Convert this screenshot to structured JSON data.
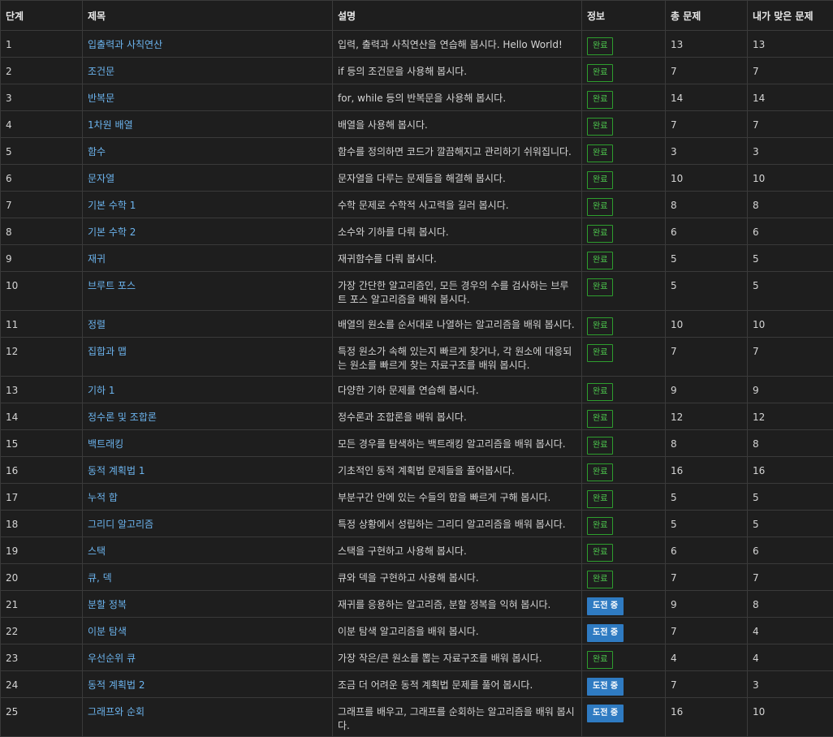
{
  "headers": [
    "단계",
    "제목",
    "설명",
    "정보",
    "총 문제",
    "내가 맞은 문제"
  ],
  "status_labels": {
    "done": "완료",
    "trying": "도전 중"
  },
  "colors": {
    "link": "#6cb4ee",
    "done": "#4ec94e",
    "trying": "#2f7bc2",
    "background": "#1e1e1e"
  },
  "rows": [
    {
      "step": "1",
      "title": "입출력과 사칙연산",
      "desc": "입력, 출력과 사칙연산을 연습해 봅시다. Hello World!",
      "status": "done",
      "status_label": "완료",
      "total": "13",
      "solved": "13"
    },
    {
      "step": "2",
      "title": "조건문",
      "desc": "if 등의 조건문을 사용해 봅시다.",
      "status": "done",
      "status_label": "완료",
      "total": "7",
      "solved": "7"
    },
    {
      "step": "3",
      "title": "반복문",
      "desc": "for, while 등의 반복문을 사용해 봅시다.",
      "status": "done",
      "status_label": "완료",
      "total": "14",
      "solved": "14"
    },
    {
      "step": "4",
      "title": "1차원 배열",
      "desc": "배열을 사용해 봅시다.",
      "status": "done",
      "status_label": "완료",
      "total": "7",
      "solved": "7"
    },
    {
      "step": "5",
      "title": "함수",
      "desc": "함수를 정의하면 코드가 깔끔해지고 관리하기 쉬워집니다.",
      "status": "done",
      "status_label": "완료",
      "total": "3",
      "solved": "3"
    },
    {
      "step": "6",
      "title": "문자열",
      "desc": "문자열을 다루는 문제들을 해결해 봅시다.",
      "status": "done",
      "status_label": "완료",
      "total": "10",
      "solved": "10"
    },
    {
      "step": "7",
      "title": "기본 수학 1",
      "desc": "수학 문제로 수학적 사고력을 길러 봅시다.",
      "status": "done",
      "status_label": "완료",
      "total": "8",
      "solved": "8"
    },
    {
      "step": "8",
      "title": "기본 수학 2",
      "desc": "소수와 기하를 다뤄 봅시다.",
      "status": "done",
      "status_label": "완료",
      "total": "6",
      "solved": "6"
    },
    {
      "step": "9",
      "title": "재귀",
      "desc": "재귀함수를 다뤄 봅시다.",
      "status": "done",
      "status_label": "완료",
      "total": "5",
      "solved": "5"
    },
    {
      "step": "10",
      "title": "브루트 포스",
      "desc": "가장 간단한 알고리즘인, 모든 경우의 수를 검사하는 브루트 포스 알고리즘을 배워 봅시다.",
      "status": "done",
      "status_label": "완료",
      "total": "5",
      "solved": "5"
    },
    {
      "step": "11",
      "title": "정렬",
      "desc": "배열의 원소를 순서대로 나열하는 알고리즘을 배워 봅시다.",
      "status": "done",
      "status_label": "완료",
      "total": "10",
      "solved": "10"
    },
    {
      "step": "12",
      "title": "집합과 맵",
      "desc": "특정 원소가 속해 있는지 빠르게 찾거나, 각 원소에 대응되는 원소를 빠르게 찾는 자료구조를 배워 봅시다.",
      "status": "done",
      "status_label": "완료",
      "total": "7",
      "solved": "7"
    },
    {
      "step": "13",
      "title": "기하 1",
      "desc": "다양한 기하 문제를 연습해 봅시다.",
      "status": "done",
      "status_label": "완료",
      "total": "9",
      "solved": "9"
    },
    {
      "step": "14",
      "title": "정수론 및 조합론",
      "desc": "정수론과 조합론을 배워 봅시다.",
      "status": "done",
      "status_label": "완료",
      "total": "12",
      "solved": "12"
    },
    {
      "step": "15",
      "title": "백트래킹",
      "desc": "모든 경우를 탐색하는 백트래킹 알고리즘을 배워 봅시다.",
      "status": "done",
      "status_label": "완료",
      "total": "8",
      "solved": "8"
    },
    {
      "step": "16",
      "title": "동적 계획법 1",
      "desc": "기초적인 동적 계획법 문제들을 풀어봅시다.",
      "status": "done",
      "status_label": "완료",
      "total": "16",
      "solved": "16"
    },
    {
      "step": "17",
      "title": "누적 합",
      "desc": "부분구간 안에 있는 수들의 합을 빠르게 구해 봅시다.",
      "status": "done",
      "status_label": "완료",
      "total": "5",
      "solved": "5"
    },
    {
      "step": "18",
      "title": "그리디 알고리즘",
      "desc": "특정 상황에서 성립하는 그리디 알고리즘을 배워 봅시다.",
      "status": "done",
      "status_label": "완료",
      "total": "5",
      "solved": "5"
    },
    {
      "step": "19",
      "title": "스택",
      "desc": "스택을 구현하고 사용해 봅시다.",
      "status": "done",
      "status_label": "완료",
      "total": "6",
      "solved": "6"
    },
    {
      "step": "20",
      "title": "큐, 덱",
      "desc": "큐와 덱을 구현하고 사용해 봅시다.",
      "status": "done",
      "status_label": "완료",
      "total": "7",
      "solved": "7"
    },
    {
      "step": "21",
      "title": "분할 정복",
      "desc": "재귀를 응용하는 알고리즘, 분할 정복을 익혀 봅시다.",
      "status": "trying",
      "status_label": "도전 중",
      "total": "9",
      "solved": "8"
    },
    {
      "step": "22",
      "title": "이분 탐색",
      "desc": "이분 탐색 알고리즘을 배워 봅시다.",
      "status": "trying",
      "status_label": "도전 중",
      "total": "7",
      "solved": "4"
    },
    {
      "step": "23",
      "title": "우선순위 큐",
      "desc": "가장 작은/큰 원소를 뽑는 자료구조를 배워 봅시다.",
      "status": "done",
      "status_label": "완료",
      "total": "4",
      "solved": "4"
    },
    {
      "step": "24",
      "title": "동적 계획법 2",
      "desc": "조금 더 어려운 동적 계획법 문제를 풀어 봅시다.",
      "status": "trying",
      "status_label": "도전 중",
      "total": "7",
      "solved": "3"
    },
    {
      "step": "25",
      "title": "그래프와 순회",
      "desc": "그래프를 배우고, 그래프를 순회하는 알고리즘을 배워 봅시다.",
      "status": "trying",
      "status_label": "도전 중",
      "total": "16",
      "solved": "10"
    }
  ]
}
